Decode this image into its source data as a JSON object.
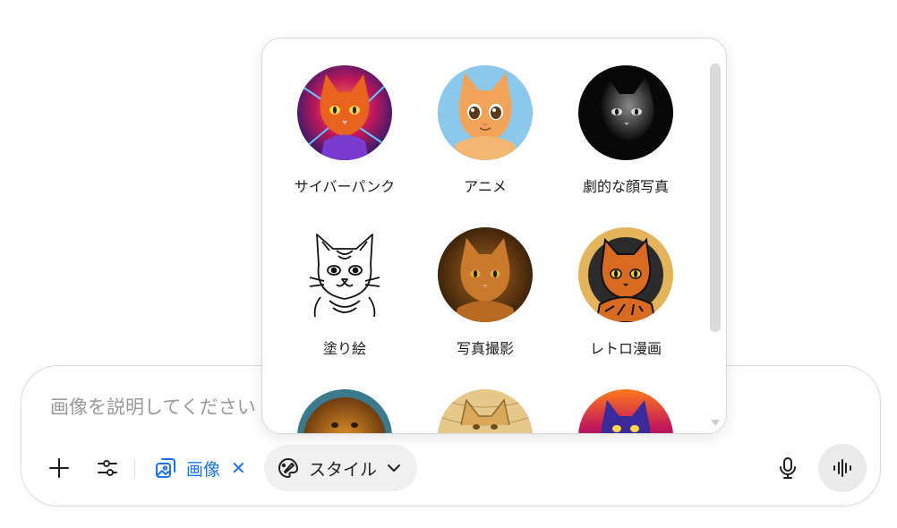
{
  "composer": {
    "placeholder": "画像を説明してください",
    "image_chip_label": "画像",
    "image_chip_close": "✕",
    "style_chip_label": "スタイル"
  },
  "style_menu": {
    "items": [
      {
        "label": "サイバーパンク",
        "theme": "cyberpunk"
      },
      {
        "label": "アニメ",
        "theme": "anime"
      },
      {
        "label": "劇的な顔写真",
        "theme": "dramatic"
      },
      {
        "label": "塗り絵",
        "theme": "coloring"
      },
      {
        "label": "写真撮影",
        "theme": "photo"
      },
      {
        "label": "レトロ漫画",
        "theme": "retro"
      },
      {
        "label": "",
        "theme": "lion"
      },
      {
        "label": "",
        "theme": "sketch"
      },
      {
        "label": "",
        "theme": "neon"
      }
    ]
  },
  "colors": {
    "accent": "#1a73e8",
    "chip_bg": "#f0f0f0"
  },
  "icons": {
    "add": "plus-icon",
    "settings": "sliders-icon",
    "image": "image-search-icon",
    "style": "palette-brush-icon",
    "mic": "microphone-icon",
    "voice": "voice-waveform-icon"
  }
}
